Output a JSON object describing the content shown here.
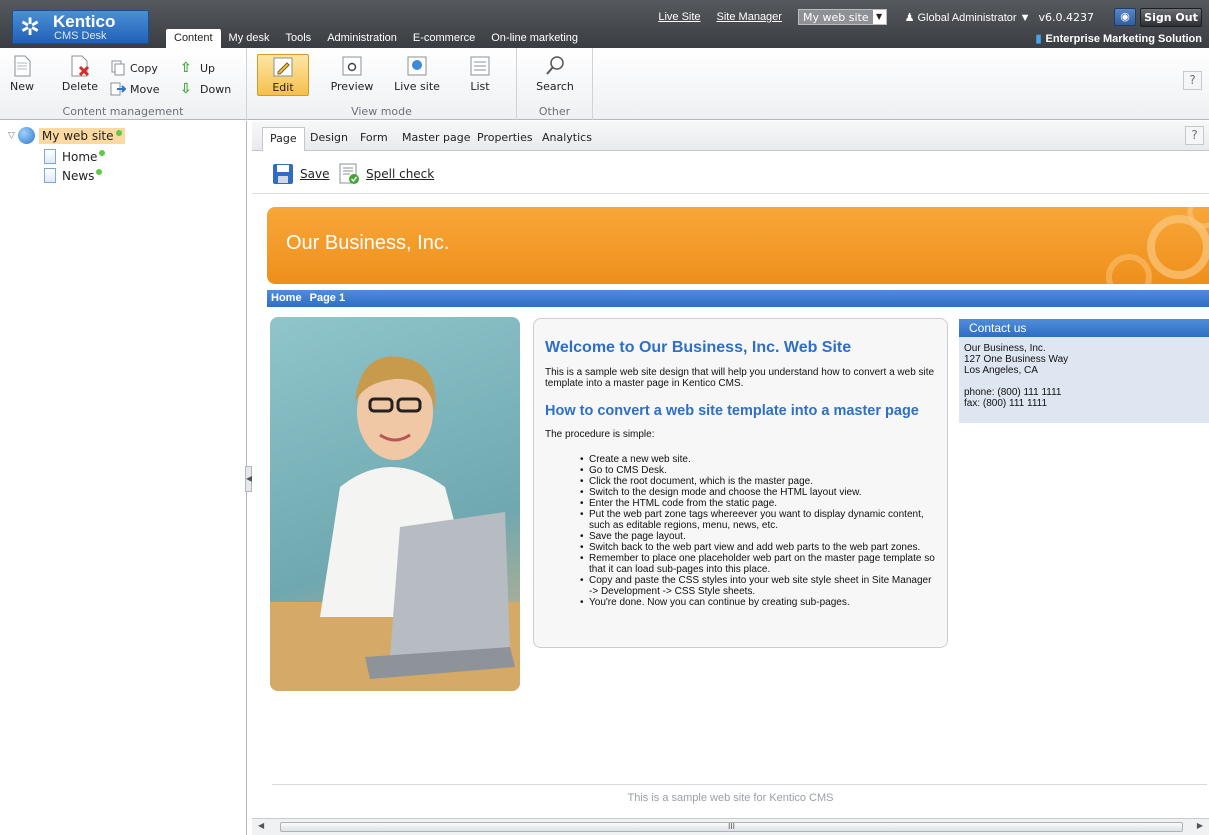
{
  "header": {
    "logo_name": "Kentico",
    "logo_sub": "CMS Desk",
    "links": [
      "Live Site",
      "Site Manager"
    ],
    "site_selector": "My web site",
    "user": "Global Administrator",
    "version": "v6.0.4237",
    "sign_out": "Sign Out",
    "tabs": [
      "Content",
      "My desk",
      "Tools",
      "Administration",
      "E-commerce",
      "On-line marketing"
    ],
    "edition": "Enterprise Marketing Solution"
  },
  "ribbon": {
    "content_management": {
      "label": "Content management",
      "new": "New",
      "delete": "Delete",
      "copy": "Copy",
      "move": "Move",
      "up": "Up",
      "down": "Down"
    },
    "view_mode": {
      "label": "View mode",
      "edit": "Edit",
      "preview": "Preview",
      "live_site": "Live site",
      "list": "List"
    },
    "other": {
      "label": "Other",
      "search": "Search"
    },
    "help": "?"
  },
  "tree": {
    "root": "My web site",
    "items": [
      "Home",
      "News"
    ]
  },
  "subtabs": [
    "Page",
    "Design",
    "Form",
    "Master page",
    "Properties",
    "Analytics"
  ],
  "actions": {
    "save": "Save",
    "spell_check": "Spell check"
  },
  "site": {
    "banner_title": "Our Business, Inc.",
    "breadcrumb": [
      "Home",
      "Page 1"
    ],
    "welcome_title": "Welcome to Our Business, Inc. Web Site",
    "intro": "This is a sample web site design that will help you understand how to convert a web site template into a master page in Kentico CMS.",
    "howto_title": "How to convert a web site template into a master page",
    "procedure": "The procedure is simple:",
    "steps": [
      "Create a new web site.",
      "Go to CMS Desk.",
      "Click the root document, which is the master page.",
      "Switch to the design mode and choose the HTML layout view.",
      "Enter the HTML code from the static page.",
      "Put the web part zone tags whereever you want to display dynamic content, such as editable regions, menu, news, etc.",
      "Save the page layout.",
      "Switch back to the web part view and add web parts to the web part zones.",
      "Remember to place one placeholder web part on the master page template so that it can load sub-pages into this place.",
      "Copy and paste the CSS styles into your web site style sheet in Site Manager -> Development -> CSS Style sheets.",
      "You're done. Now you can continue by creating sub-pages."
    ],
    "contact": {
      "title": "Contact us",
      "company": "Our Business, Inc.",
      "street": "127 One Business Way",
      "city": "Los Angeles, CA",
      "phone": "phone: (800) 111 1111",
      "fax": "fax: (800) 111 1111"
    },
    "footer": "This is a sample web site for Kentico CMS"
  },
  "scrollbar": {
    "grip": "III"
  }
}
